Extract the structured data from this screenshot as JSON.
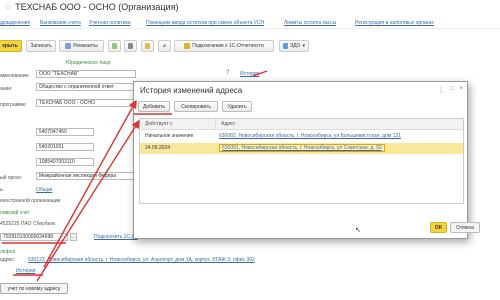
{
  "window": {
    "title": "ТЕХСНАБ ООО - ОСНО (Организация)"
  },
  "nav": [
    "дразделения",
    "Банковские счета",
    "Учетная политика",
    "Помощник ввода остатков при смене объекта УСН",
    "Лимиты остатка кассы",
    "Регистрация в налоговых органах"
  ],
  "toolbar": {
    "save_close": "крыть",
    "save": "Записать",
    "requisites": "Реквизиты",
    "connect_1c": "Подключение к 1С-Отчетности",
    "edo": "ЭДО"
  },
  "form": {
    "subtitle": "Юридическое лицо",
    "name_label": "именование:",
    "name_value": "ООО \"ТЕХСНАБ\"",
    "history_link": "История",
    "full_label": "ание:",
    "full_value": "Общество с ограниченной ответ",
    "prog_label": "программе:",
    "prog_value": "ТЕХСНАБ ООО - ОСНО",
    "inn": "5407047450",
    "kpp": "540201001",
    "ogrn": "1085407003110",
    "organ_label": "ый орган:",
    "organ_value": "Межрайонная инспекция Федера",
    "attr_label": "ь:",
    "attr_link": "Общая",
    "foreign_label": "иностранной организации",
    "bank_label": "новский счет",
    "bank_value": "4525225 ПАО Сбербанк",
    "account_value": "702810100000034698",
    "connect_link": "Подключить 1С:Ди",
    "fon_label": "лефон",
    "address_label": "адрес:",
    "address_value": "630123, Новосибирская область, г. Новосибирск, ул. Аэропорт, дом 1А, корпус ЭТАЖ 3, офис 302",
    "history_bottom": "История",
    "bottom_button": "учет по новому адресу"
  },
  "dialog": {
    "title": "История изменений адреса",
    "add": "Добавить",
    "copy": "Скопировать",
    "delete": "Удалить",
    "col_date": "Действует с",
    "col_address": "Адрес",
    "rows": [
      {
        "date": "Начальное значение",
        "address": "630083, Новосибирская область, г. Новосибирск, ул Большевистская, дом 131"
      },
      {
        "date": "24.09.2024",
        "address": "630091, Новосибирская область, г. Новосибирск, ул Советская, д. 50"
      }
    ],
    "ok": "OK",
    "cancel": "Отмена"
  }
}
